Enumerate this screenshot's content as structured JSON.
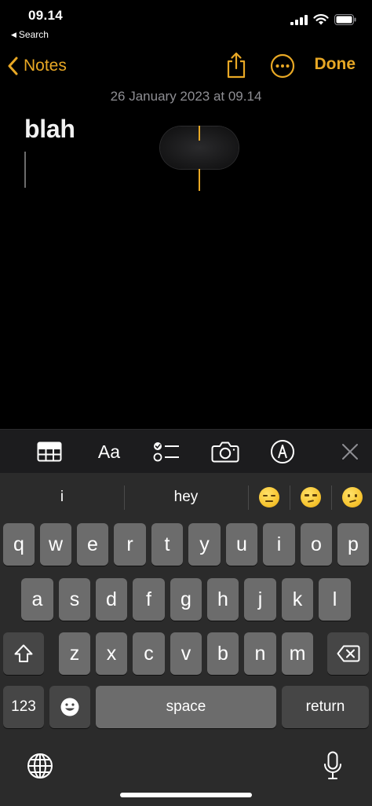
{
  "status_bar": {
    "time": "09.14",
    "back_app": "Search",
    "icons": [
      "cellular-signal-icon",
      "wifi-icon",
      "battery-icon"
    ]
  },
  "nav": {
    "back_label": "Notes",
    "done_label": "Done",
    "icons": [
      "chevron-left-icon",
      "share-icon",
      "more-icon"
    ]
  },
  "note": {
    "date": "26 January 2023 at 09.14",
    "title": "blah"
  },
  "toolbar": {
    "format_label": "Aa",
    "icons": [
      "table-icon",
      "format-icon",
      "checklist-icon",
      "camera-icon",
      "markup-icon",
      "close-icon"
    ]
  },
  "keyboard": {
    "suggestions": [
      "i",
      "hey"
    ],
    "emoji_suggestions": [
      "expressionless-face-icon",
      "unamused-face-icon",
      "confused-face-icon"
    ],
    "row1": [
      "q",
      "w",
      "e",
      "r",
      "t",
      "y",
      "u",
      "i",
      "o",
      "p"
    ],
    "row2": [
      "a",
      "s",
      "d",
      "f",
      "g",
      "h",
      "j",
      "k",
      "l"
    ],
    "row3": [
      "z",
      "x",
      "c",
      "v",
      "b",
      "n",
      "m"
    ],
    "numbers_label": "123",
    "space_label": "space",
    "return_label": "return",
    "icons": [
      "shift-icon",
      "backspace-icon",
      "emoji-icon",
      "globe-icon",
      "microphone-icon"
    ]
  },
  "colors": {
    "accent": "#e8a825",
    "background": "#000000",
    "key": "#6c6c6c",
    "function_key": "#464646",
    "keyboard_bg": "#2b2b2b"
  }
}
